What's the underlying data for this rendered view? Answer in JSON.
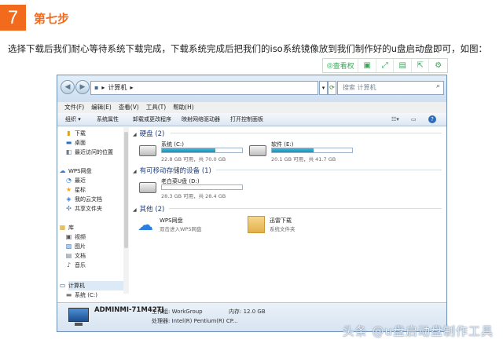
{
  "step": {
    "number": "7",
    "title": "第七步"
  },
  "paragraph": "选择下载后我们耐心等待系统下载完成，下载系统完成后把我们的iso系统镜像放到我们制作好的u盘启动盘即可，如图：",
  "image_toolbar": {
    "quick_view": "查看权",
    "icons": [
      "ocr-icon",
      "expand-icon",
      "save-icon",
      "share-icon",
      "settings-icon"
    ]
  },
  "window": {
    "nav": {
      "back": "◀",
      "forward": "▶"
    },
    "address": {
      "path_icon": "▸",
      "path": "计算机",
      "sep": "▸"
    },
    "search_placeholder": "搜索 计算机",
    "menu": [
      "文件(F)",
      "编辑(E)",
      "查看(V)",
      "工具(T)",
      "帮助(H)"
    ],
    "commands": [
      "组织 ▾",
      "系统属性",
      "卸载或更改程序",
      "映射网络驱动器",
      "打开控制面板"
    ],
    "sidebar": [
      {
        "label": "下载",
        "icon": "folder-icon"
      },
      {
        "label": "桌面",
        "icon": "desktop-icon"
      },
      {
        "label": "最近访问的位置",
        "icon": "recent-icon"
      },
      {
        "label": "WPS网盘",
        "icon": "cloud-icon"
      },
      {
        "label": "最近",
        "icon": "recent-icon"
      },
      {
        "label": "星标",
        "icon": "star-icon"
      },
      {
        "label": "我的云文档",
        "icon": "cloud-doc-icon"
      },
      {
        "label": "共享文件夹",
        "icon": "share-folder-icon"
      },
      {
        "label": "库",
        "icon": "library-icon"
      },
      {
        "label": "视频",
        "icon": "video-icon"
      },
      {
        "label": "图片",
        "icon": "picture-icon"
      },
      {
        "label": "文档",
        "icon": "document-icon"
      },
      {
        "label": "音乐",
        "icon": "music-icon"
      },
      {
        "label": "计算机",
        "icon": "computer-icon"
      },
      {
        "label": "系统 (C:)",
        "icon": "drive-icon"
      }
    ],
    "sections": {
      "hdd": "硬盘 (2)",
      "removable": "有可移动存储的设备 (1)",
      "other": "其他 (2)"
    },
    "drives": [
      {
        "name": "系统 (C:)",
        "space": "22.8 GB 可用，共 70.0 GB",
        "used_fraction": 0.67
      },
      {
        "name": "软件 (E:)",
        "space": "20.1 GB 可用，共 41.7 GB",
        "used_fraction": 0.52
      },
      {
        "name": "老白菜U盘 (D:)",
        "space": "28.3 GB 可用，共 28.4 GB",
        "used_fraction": 0.0
      }
    ],
    "others": [
      {
        "title": "WPS网盘",
        "sub": "双击进入WPS网盘"
      },
      {
        "title": "迅雷下载",
        "sub": "系统文件夹"
      }
    ],
    "status": {
      "computer_name": "ADMINMI-71M42TJ",
      "workgroup": "工作组: WorkGroup",
      "memory": "内存: 12.0 GB",
      "processor": "处理器: Intel(R) Pentium(R) CP..."
    }
  },
  "watermark": "头条 @u盘启动盘制作工具",
  "colors": {
    "accent": "#f26b1d",
    "bar": "#2aa0c6",
    "link": "#1e3d7a"
  }
}
